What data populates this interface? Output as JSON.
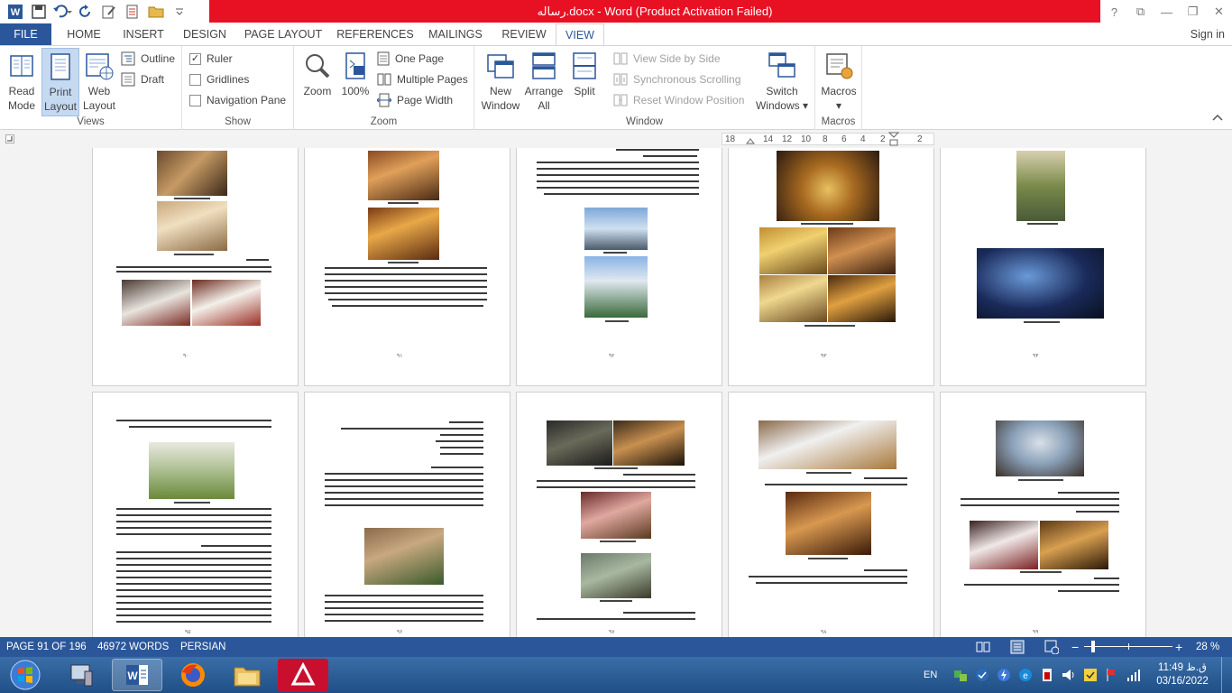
{
  "window": {
    "title": "رساله.docx -  Word (Product Activation Failed)",
    "controls": [
      "?",
      "⧉",
      "—",
      "❐",
      "✕"
    ]
  },
  "tabs": {
    "file": "FILE",
    "items": [
      "HOME",
      "INSERT",
      "DESIGN",
      "PAGE LAYOUT",
      "REFERENCES",
      "MAILINGS",
      "REVIEW",
      "VIEW"
    ],
    "active": "VIEW",
    "signin": "Sign in"
  },
  "ribbon": {
    "views": {
      "label": "Views",
      "read_mode": "Read\nMode",
      "print_layout": "Print\nLayout",
      "web_layout": "Web\nLayout",
      "outline": "Outline",
      "draft": "Draft"
    },
    "show": {
      "label": "Show",
      "ruler": "Ruler",
      "ruler_checked": true,
      "gridlines": "Gridlines",
      "gridlines_checked": false,
      "navigation_pane": "Navigation Pane",
      "navigation_pane_checked": false
    },
    "zoom": {
      "label": "Zoom",
      "zoom": "Zoom",
      "hundred": "100%",
      "one_page": "One Page",
      "multiple_pages": "Multiple Pages",
      "page_width": "Page Width"
    },
    "window": {
      "label": "Window",
      "new_window": "New\nWindow",
      "arrange_all": "Arrange\nAll",
      "split": "Split",
      "view_side_by_side": "View Side by Side",
      "synchronous_scrolling": "Synchronous Scrolling",
      "reset_window_position": "Reset Window Position",
      "switch_windows": "Switch\nWindows ▾"
    },
    "macros": {
      "label": "Macros",
      "macros": "Macros\n▾"
    }
  },
  "ruler": {
    "ticks": [
      "18",
      "14",
      "12",
      "10",
      "8",
      "6",
      "4",
      "2",
      "2"
    ]
  },
  "status": {
    "page": "PAGE 91 OF 196",
    "words": "46972 WORDS",
    "language": "PERSIAN",
    "zoom": "28 %",
    "zoom_minus": "−",
    "zoom_plus": "+"
  },
  "taskbar": {
    "lang": "EN",
    "time": "11:49 ق.ظ",
    "date": "03/16/2022"
  }
}
